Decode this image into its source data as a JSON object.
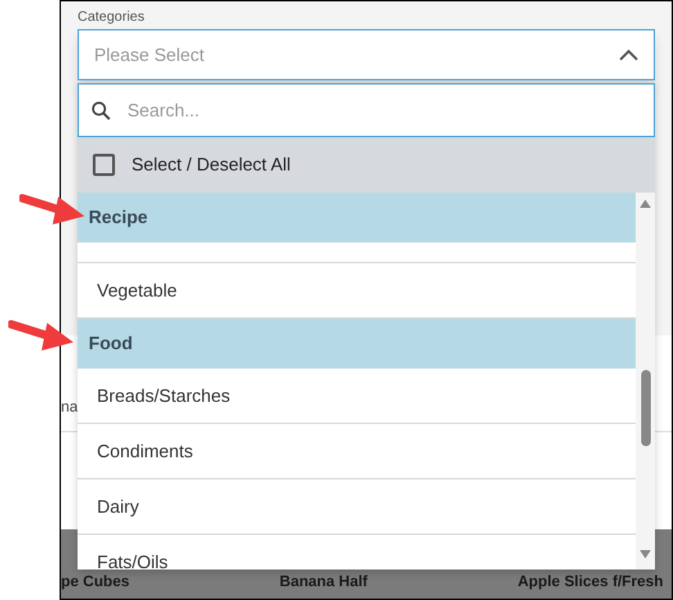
{
  "field": {
    "label": "Categories",
    "placeholder": "Please Select",
    "expanded": true
  },
  "search": {
    "placeholder": "Search..."
  },
  "select_all": {
    "label": "Select / Deselect All",
    "checked": false
  },
  "list": [
    {
      "kind": "group",
      "label": "Recipe"
    },
    {
      "kind": "option",
      "label": "Vegetable"
    },
    {
      "kind": "group",
      "label": "Food"
    },
    {
      "kind": "option",
      "label": "Breads/Starches"
    },
    {
      "kind": "option",
      "label": "Condiments"
    },
    {
      "kind": "option",
      "label": "Dairy"
    },
    {
      "kind": "option",
      "label": "Fats/Oils"
    }
  ],
  "background": {
    "partial_label": "na",
    "footer_items": [
      "pe Cubes",
      "Banana Half",
      "Apple Slices f/Fresh"
    ]
  }
}
